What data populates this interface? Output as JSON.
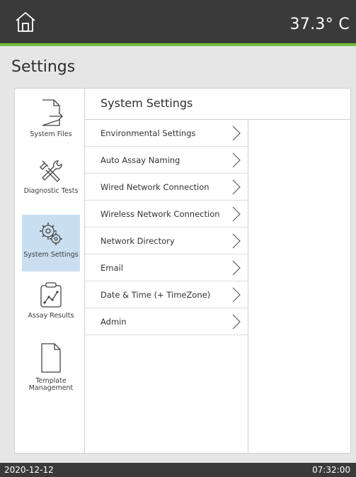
{
  "header": {
    "home_icon": "home-icon",
    "temperature": "37.3° C",
    "accent_color": "#6cbf3a"
  },
  "page": {
    "title": "Settings"
  },
  "sidebar": {
    "items": [
      {
        "label": "System Files",
        "icon": "file-export-icon",
        "active": false
      },
      {
        "label": "Diagnostic Tests",
        "icon": "tools-icon",
        "active": false
      },
      {
        "label": "System Settings",
        "icon": "gears-icon",
        "active": true
      },
      {
        "label": "Assay Results",
        "icon": "chart-icon",
        "active": false
      },
      {
        "label": "Template Management",
        "icon": "document-icon",
        "active": false
      }
    ],
    "active_color": "#c9dff1"
  },
  "content": {
    "title": "System Settings",
    "menu": [
      {
        "label": "Environmental Settings"
      },
      {
        "label": "Auto Assay Naming"
      },
      {
        "label": "Wired Network Connection"
      },
      {
        "label": "Wireless Network Connection"
      },
      {
        "label": "Network Directory"
      },
      {
        "label": "Email"
      },
      {
        "label": "Date & Time (+ TimeZone)"
      },
      {
        "label": "Admin"
      }
    ]
  },
  "footer": {
    "date": "2020-12-12",
    "time": "07:32:00"
  }
}
